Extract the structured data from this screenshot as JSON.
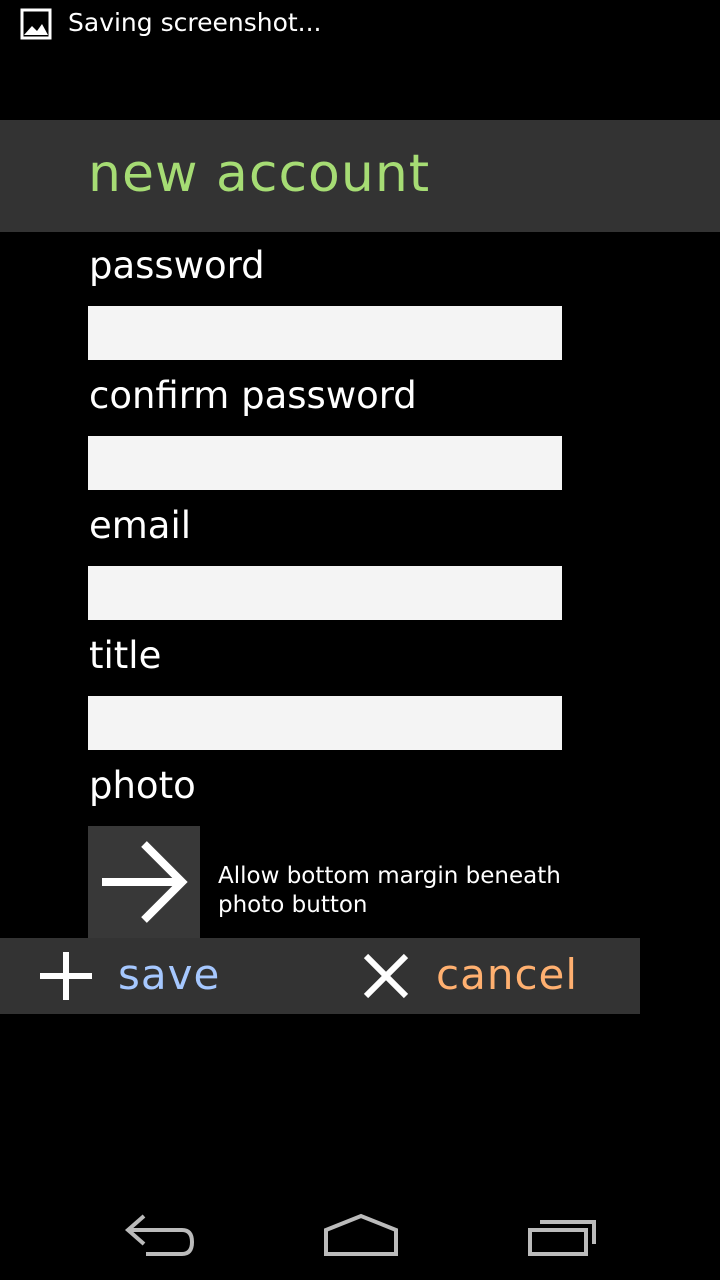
{
  "status_bar": {
    "notification_icon": "image-icon",
    "notification_text": "Saving screenshot..."
  },
  "header": {
    "title": "new account"
  },
  "form": {
    "fields": [
      {
        "label": "password",
        "value": ""
      },
      {
        "label": "confirm password",
        "value": ""
      },
      {
        "label": "email",
        "value": ""
      },
      {
        "label": "title",
        "value": ""
      }
    ],
    "photo": {
      "label": "photo",
      "button_icon": "arrow-right-icon",
      "note": "Allow bottom margin beneath photo button"
    }
  },
  "actions": {
    "save_icon": "plus-icon",
    "save_label": "save",
    "cancel_icon": "close-icon",
    "cancel_label": "cancel"
  },
  "nav": {
    "back_icon": "back-icon",
    "home_icon": "home-icon",
    "recent_icon": "recent-apps-icon"
  },
  "colors": {
    "title": "#a6dc74",
    "save": "#a6c8ff",
    "cancel": "#ffb070",
    "bar_background": "#333333"
  }
}
